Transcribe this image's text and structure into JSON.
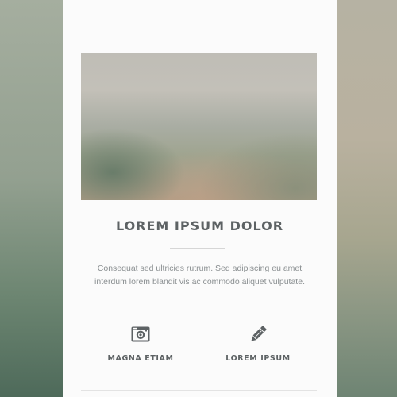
{
  "card": {
    "title": "LOREM IPSUM DOLOR",
    "description_lines": [
      "Consequat sed ultricies rutrum. Sed adipiscing eu amet",
      "interdum lorem blandit vis ac commodo aliquet vulputate."
    ],
    "features": [
      {
        "icon": "camera-icon",
        "label": "MAGNA ETIAM"
      },
      {
        "icon": "pencil-icon",
        "label": "LOREM IPSUM"
      }
    ]
  },
  "colors": {
    "text_dark": "#5d6264",
    "text_muted": "#8a8f91",
    "card_bg": "#fbfbfb"
  }
}
